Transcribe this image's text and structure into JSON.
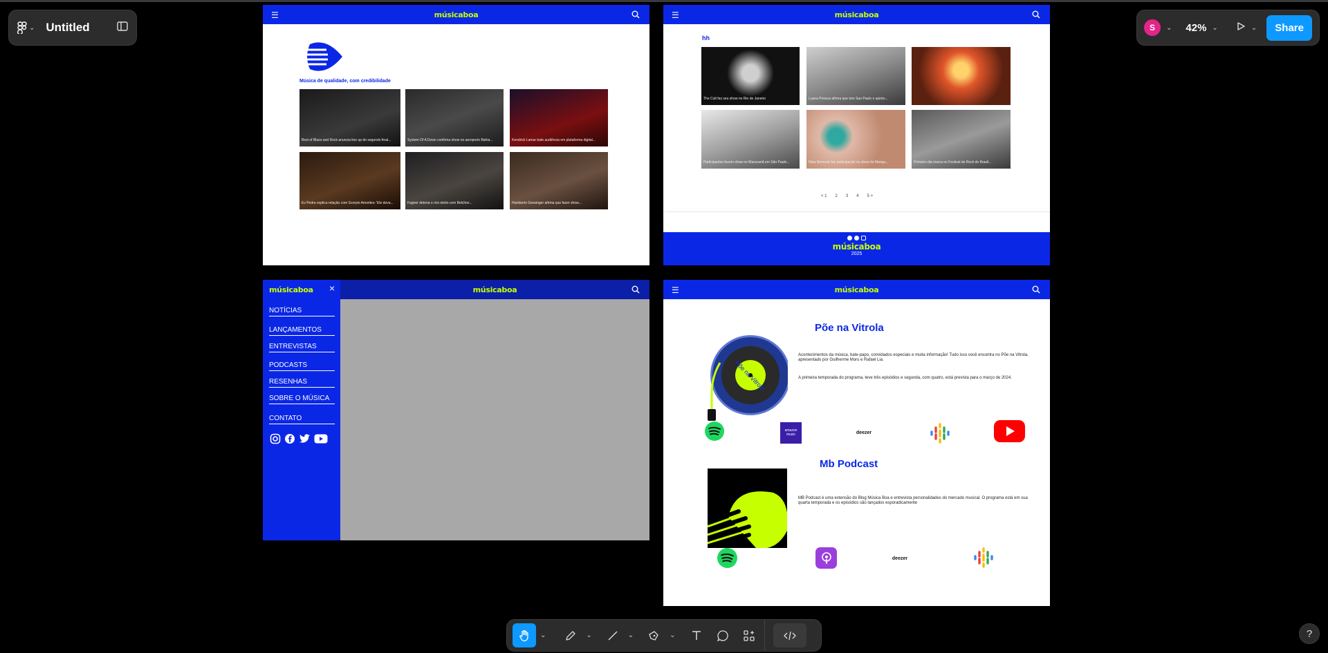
{
  "app": {
    "file_name": "Untitled",
    "zoom": "42%",
    "share_label": "Share",
    "user_initial": "S",
    "help_label": "?"
  },
  "site": {
    "logo": "músicaboa",
    "tagline": "Música de qualidade, com credibilidade",
    "news_top": [
      "Best of Blues and Rock anuncia line up do segundo final...",
      "System Of A Down confirma show no aeroporto Bahia...",
      "Kendrick Lamar bate audiência em plataforma digital..."
    ],
    "news_bottom": [
      "Ev Pedra explica relação com Scorpio Amorites: 'Ele deva...",
      "Fagner detona o rivo eleito com Belchior...",
      "Humberto Gessinger afirma que fazer show..."
    ]
  },
  "frame2": {
    "heading": "hh",
    "cards_top": [
      "The Cult faz seu show no Rio de Janeiro",
      "Luana Pessoa afirma que tem Sao Paulo o quinto...",
      ""
    ],
    "cards_bottom": [
      "Participantes fazem show no Maracanã em São Paulo...",
      "Nina Nemesis faz participação no show de Maruja...",
      "Primeiro dia marca no Festival de Rock do Brasil..."
    ],
    "pagination": [
      "< 1",
      "2",
      "3",
      "4",
      "5 >"
    ],
    "footer_year": "2025"
  },
  "menu": {
    "items": [
      "NOTÍCIAS",
      "LANÇAMENTOS",
      "ENTREVISTAS",
      "PODCASTS",
      "RESENHAS",
      "SOBRE O MÚSICA",
      "CONTATO"
    ],
    "close": "×"
  },
  "podcasts": {
    "vitrola_title": "Põe na Vitrola",
    "vitrola_p1": "Acontecimentos da música, bate-papo, convidados especiais e muita informação! Tudo isso você encontra no Põe na Vitrola, apresentado por Guilherme Moro e Rafael Lia.",
    "vitrola_p2": "A primeira temporada do programa, teve três episódios e segunda, com quatro, está prevista para o março de 2024.",
    "vinyl_label": "Põe na Vitrola",
    "mb_title": "Mb Podcast",
    "mb_p1": "MB Podcast é uma extensão do Blog Música Boa e entrevista personalidades do mercado musical. O programa está em sua quarta temporada e os episódios são lançados esporadicamente",
    "amazon_label": "amazon music",
    "deezer_label": "deezer"
  },
  "colors": {
    "brand_blue": "#0b27e6",
    "brand_lime": "#c6ff00",
    "figma_accent": "#0d99ff"
  }
}
